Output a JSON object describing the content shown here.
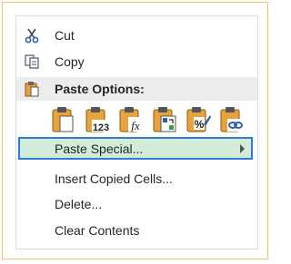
{
  "context_menu": {
    "cut": {
      "label": "Cut",
      "icon": "scissors-icon"
    },
    "copy": {
      "label": "Copy",
      "icon": "copy-icon"
    },
    "paste_options_header": {
      "label": "Paste Options:",
      "icon": "clipboard-icon"
    },
    "paste_options": [
      {
        "name": "paste",
        "icon": "clipboard-paste-icon"
      },
      {
        "name": "paste-values",
        "icon": "clipboard-123-icon",
        "text": "123"
      },
      {
        "name": "paste-formulas",
        "icon": "clipboard-fx-icon",
        "text": "fx"
      },
      {
        "name": "paste-transpose",
        "icon": "clipboard-transpose-icon"
      },
      {
        "name": "paste-formatting",
        "icon": "clipboard-format-icon",
        "text": "%"
      },
      {
        "name": "paste-link",
        "icon": "clipboard-link-icon"
      }
    ],
    "paste_special": {
      "label": "Paste Special...",
      "has_submenu": true
    },
    "insert_copied_cells": {
      "label": "Insert Copied Cells..."
    },
    "delete": {
      "label": "Delete..."
    },
    "clear_contents": {
      "label": "Clear Contents"
    }
  },
  "colors": {
    "frame_border": "#f0c75a",
    "highlight_fill": "#d3ebd9",
    "highlight_border": "#2f7bd6",
    "clipboard_orange": "#e8a33d",
    "header_bg": "#ececec"
  }
}
